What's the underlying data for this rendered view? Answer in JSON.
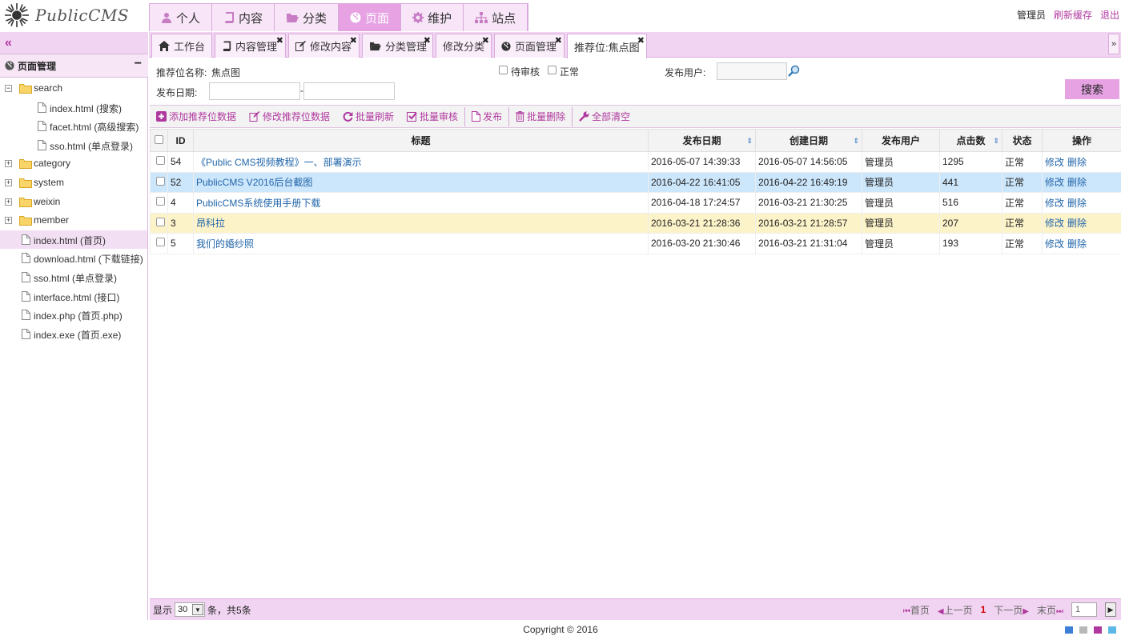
{
  "app": {
    "logo_text": "PublicCMS"
  },
  "nav": {
    "items": [
      {
        "label": "个人",
        "icon": "user-icon"
      },
      {
        "label": "内容",
        "icon": "book-icon"
      },
      {
        "label": "分类",
        "icon": "folder-open-icon"
      },
      {
        "label": "页面",
        "icon": "globe-icon"
      },
      {
        "label": "维护",
        "icon": "gear-icon"
      },
      {
        "label": "站点",
        "icon": "sitemap-icon"
      }
    ],
    "active": "页面"
  },
  "topbar": {
    "user": "管理员",
    "refresh_cache": "刷新缓存",
    "logout": "退出"
  },
  "sidebar": {
    "collapse_glyph": "«",
    "panel_title": "页面管理",
    "panel_minimize": "−",
    "tree": [
      {
        "label": "search",
        "type": "folder",
        "expanded": true,
        "toggle": "−"
      },
      {
        "label": "index.html (搜索)",
        "type": "file"
      },
      {
        "label": "facet.html (高级搜索)",
        "type": "file"
      },
      {
        "label": "sso.html (单点登录)",
        "type": "file"
      },
      {
        "label": "category",
        "type": "folder",
        "toggle": "+"
      },
      {
        "label": "system",
        "type": "folder",
        "toggle": "+"
      },
      {
        "label": "weixin",
        "type": "folder",
        "toggle": "+"
      },
      {
        "label": "member",
        "type": "folder",
        "toggle": "+"
      },
      {
        "label": "index.html (首页)",
        "type": "file",
        "selected": true
      },
      {
        "label": "download.html (下载链接)",
        "type": "file"
      },
      {
        "label": "sso.html (单点登录)",
        "type": "file"
      },
      {
        "label": "interface.html (接口)",
        "type": "file"
      },
      {
        "label": "index.php (首页.php)",
        "type": "file"
      },
      {
        "label": "index.exe (首页.exe)",
        "type": "file"
      }
    ]
  },
  "tabs": {
    "items": [
      {
        "label": "工作台",
        "closable": false
      },
      {
        "label": "内容管理",
        "closable": true
      },
      {
        "label": "修改内容",
        "closable": true
      },
      {
        "label": "分类管理",
        "closable": true
      },
      {
        "label": "修改分类",
        "closable": true
      },
      {
        "label": "页面管理",
        "closable": true
      },
      {
        "label": "推荐位:焦点图",
        "closable": true,
        "active": true
      }
    ],
    "close_glyph": "✖",
    "menu_glyph": "»"
  },
  "search": {
    "position_label": "推荐位名称:",
    "position_value": "焦点图",
    "pending_label": "待审核",
    "normal_label": "正常",
    "publisher_label": "发布用户:",
    "publisher_value": "",
    "date_label": "发布日期:",
    "date_sep": "-",
    "date_start": "",
    "date_end": "",
    "button": "搜索"
  },
  "toolbar": {
    "add": "添加推荐位数据",
    "edit": "修改推荐位数据",
    "refresh": "批量刷新",
    "check": "批量审核",
    "publish": "发布",
    "delete": "批量删除",
    "clear": "全部清空"
  },
  "table": {
    "columns": [
      "ID",
      "标题",
      "发布日期",
      "创建日期",
      "发布用户",
      "点击数",
      "状态",
      "操作"
    ],
    "rows": [
      {
        "id": "54",
        "title": "《Public CMS视频教程》一、部署演示",
        "publish_date": "2016-05-07 14:39:33",
        "create_date": "2016-05-07 14:56:05",
        "user": "管理员",
        "clicks": "1295",
        "status": "正常",
        "edit": "修改",
        "del": "删除"
      },
      {
        "id": "52",
        "title": "PublicCMS V2016后台截图",
        "publish_date": "2016-04-22 16:41:05",
        "create_date": "2016-04-22 16:49:19",
        "user": "管理员",
        "clicks": "441",
        "status": "正常",
        "edit": "修改",
        "del": "删除"
      },
      {
        "id": "4",
        "title": "PublicCMS系统使用手册下载",
        "publish_date": "2016-04-18 17:24:57",
        "create_date": "2016-03-21 21:30:25",
        "user": "管理员",
        "clicks": "516",
        "status": "正常",
        "edit": "修改",
        "del": "删除"
      },
      {
        "id": "3",
        "title": "昂科拉",
        "publish_date": "2016-03-21 21:28:36",
        "create_date": "2016-03-21 21:28:57",
        "user": "管理员",
        "clicks": "207",
        "status": "正常",
        "edit": "修改",
        "del": "删除"
      },
      {
        "id": "5",
        "title": "我们的婚纱照",
        "publish_date": "2016-03-20 21:30:46",
        "create_date": "2016-03-21 21:31:04",
        "user": "管理员",
        "clicks": "193",
        "status": "正常",
        "edit": "修改",
        "del": "删除"
      }
    ]
  },
  "pager": {
    "show_label": "显示",
    "page_size": "30",
    "total_text": "条，共5条",
    "first": "首页",
    "prev": "上一页",
    "current": "1",
    "next": "下一页",
    "last": "末页",
    "jump_value": "1"
  },
  "footer": {
    "copyright": "Copyright © 2016"
  },
  "colors": {
    "accent": "#b0399f",
    "nav_active": "#e6a2e3",
    "panel_bg": "#f1d4f1",
    "link": "#2266aa",
    "row_selected": "#cce6fb",
    "row_highlight": "#fdf3c9"
  },
  "theme_swatches": [
    "#3b7fd6",
    "#b8b8b8",
    "#b0399f",
    "#5cb8e6"
  ]
}
